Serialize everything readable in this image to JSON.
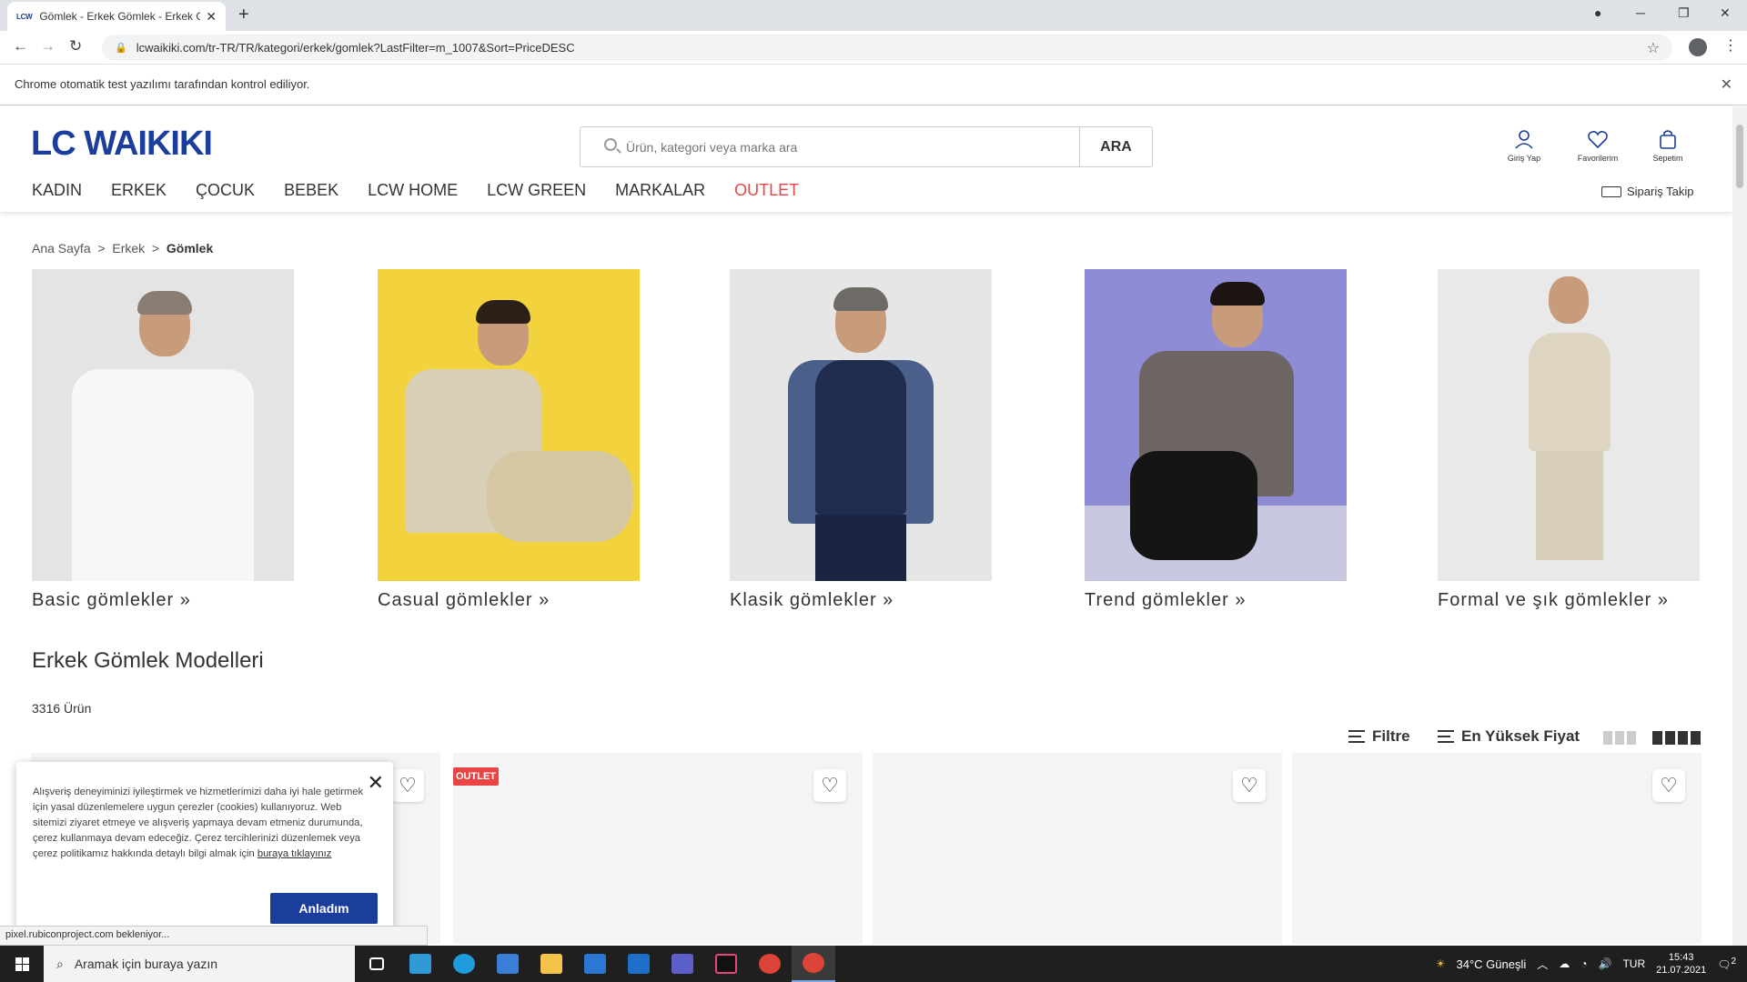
{
  "browser": {
    "tab_favicon": "LCW",
    "tab_title": "Gömlek - Erkek Gömlek - Erkek Gömlek",
    "url": "lcwaikiki.com/tr-TR/TR/kategori/erkek/gomlek?LastFilter=m_1007&Sort=PriceDESC",
    "infobar": "Chrome otomatik test yazılımı tarafından kontrol ediliyor.",
    "status_url": "pixel.rubiconproject.com bekleniyor..."
  },
  "header": {
    "logo": "LC WAIKIKI",
    "search_placeholder": "Ürün, kategori veya marka ara",
    "search_button": "ARA",
    "login": "Giriş Yap",
    "favorites": "Favorilerim",
    "cart": "Sepetim",
    "order_tracking": "Sipariş Takip",
    "nav": [
      "KADIN",
      "ERKEK",
      "ÇOCUK",
      "BEBEK",
      "LCW HOME",
      "LCW GREEN",
      "MARKALAR",
      "OUTLET"
    ]
  },
  "breadcrumb": [
    "Ana Sayfa",
    "Erkek",
    "Gömlek"
  ],
  "categories": [
    {
      "label": "Basic gömlekler  »"
    },
    {
      "label": "Casual gömlekler  »"
    },
    {
      "label": "Klasik gömlekler  »"
    },
    {
      "label": "Trend gömlekler  »"
    },
    {
      "label": "Formal ve şık gömlekler »"
    }
  ],
  "listing": {
    "title": "Erkek Gömlek Modelleri",
    "count": "3316 Ürün",
    "filter": "Filtre",
    "sort": "En Yüksek Fiyat",
    "outlet_badge": "OUTLET"
  },
  "cookie": {
    "text": "Alışveriş deneyiminizi iyileştirmek ve hizmetlerimizi daha iyi hale getirmek için yasal düzenlemelere uygun çerezler (cookies) kullanıyoruz. Web sitemizi ziyaret etmeye ve alışveriş yapmaya devam etmeniz durumunda, çerez kullanmaya devam edeceğiz. Çerez tercihlerinizi düzenlemek veya çerez politikamız hakkında detaylı bilgi almak için",
    "link": "buraya tıklayınız",
    "button": "Anladım"
  },
  "taskbar": {
    "search": "Aramak için buraya yazın",
    "weather": "34°C  Güneşli",
    "lang": "TUR",
    "time": "15:43",
    "date": "21.07.2021",
    "notifications": "2"
  },
  "colors": {
    "brand": "#1b3d9c",
    "outlet": "#e94545"
  }
}
